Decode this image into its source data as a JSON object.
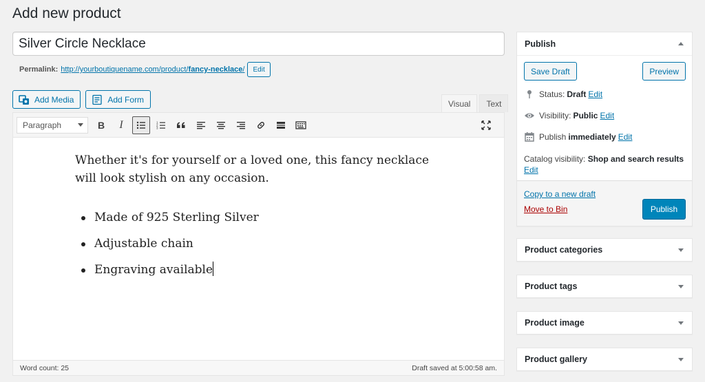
{
  "page": {
    "title": "Add new product"
  },
  "product": {
    "title_value": "Silver Circle Necklace",
    "permalink_label": "Permalink:",
    "permalink_base": "http://yourboutiquename.com/product/",
    "permalink_slug": "fancy-necklace",
    "permalink_trail": "/",
    "permalink_edit": "Edit"
  },
  "media": {
    "add_media": "Add Media",
    "add_form": "Add Form"
  },
  "editor": {
    "tab_visual": "Visual",
    "tab_text": "Text",
    "format_select": "Paragraph",
    "paragraph": "Whether it's for yourself or a loved one, this fancy necklace will look stylish on any occasion.",
    "bullets": [
      "Made of 925 Sterling Silver",
      "Adjustable chain",
      "Engraving available"
    ],
    "word_count": "Word count: 25",
    "draft_saved": "Draft saved at 5:00:58 am."
  },
  "toolbar_icons": [
    "bold-icon",
    "italic-icon",
    "bullet-list-icon",
    "numbered-list-icon",
    "blockquote-icon",
    "align-left-icon",
    "align-center-icon",
    "align-right-icon",
    "link-icon",
    "read-more-icon",
    "toolbar-toggle-icon",
    "fullscreen-icon"
  ],
  "publish": {
    "heading": "Publish",
    "save_draft": "Save Draft",
    "preview": "Preview",
    "status_label": "Status:",
    "status_value": "Draft",
    "visibility_label": "Visibility:",
    "visibility_value": "Public",
    "publish_label": "Publish",
    "publish_value": "immediately",
    "edit": "Edit",
    "catalog_label": "Catalog visibility:",
    "catalog_value": "Shop and search results",
    "copy_draft": "Copy to a new draft",
    "move_to_bin": "Move to Bin",
    "publish_button": "Publish"
  },
  "boxes": {
    "categories": "Product categories",
    "tags": "Product tags",
    "image": "Product image",
    "gallery": "Product gallery"
  },
  "colors": {
    "accent": "#0073aa",
    "primary_button": "#0085ba",
    "danger": "#a00"
  }
}
